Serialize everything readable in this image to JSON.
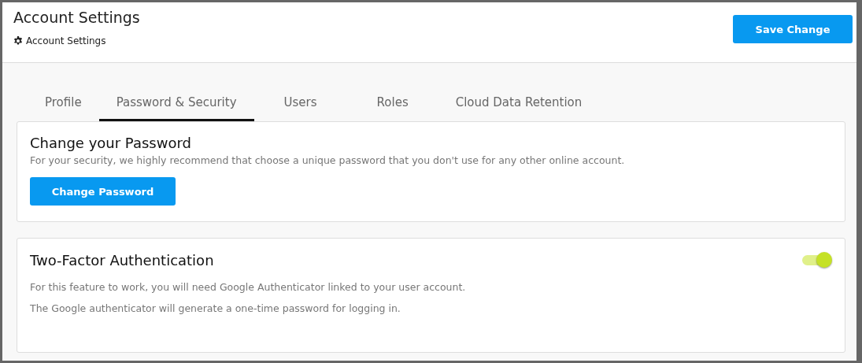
{
  "header": {
    "title": "Account Settings",
    "breadcrumb": "Account Settings",
    "save_button": "Save Change"
  },
  "tabs": [
    {
      "label": "Profile",
      "selected": false
    },
    {
      "label": "Password & Security",
      "selected": true
    },
    {
      "label": "Users",
      "selected": false
    },
    {
      "label": "Roles",
      "selected": false
    },
    {
      "label": "Cloud Data Retention",
      "selected": false
    }
  ],
  "password_card": {
    "title": "Change your Password",
    "description": "For your security, we highly recommend that choose a unique password that you don't use for any other online account.",
    "button": "Change Password"
  },
  "two_factor_card": {
    "title": "Two-Factor Authentication",
    "on": true,
    "lines": [
      "For this feature to work, you will need Google Authenticator linked to your user account.",
      "The Google authenticator will generate a one-time password for logging in."
    ]
  }
}
